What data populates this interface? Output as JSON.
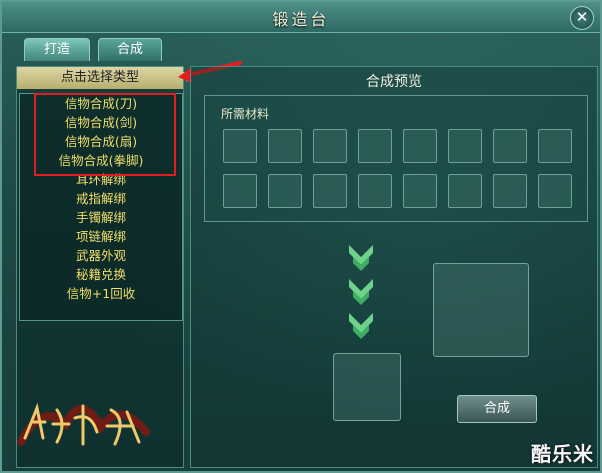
{
  "window": {
    "title": "锻造台"
  },
  "tabs": [
    {
      "label": "打造",
      "active": true
    },
    {
      "label": "合成",
      "active": false
    }
  ],
  "type_selector": {
    "label": "点击选择类型"
  },
  "type_list": [
    "信物合成(刀)",
    "信物合成(剑)",
    "信物合成(扇)",
    "信物合成(拳脚)",
    "耳环解绑",
    "戒指解绑",
    "手镯解绑",
    "项链解绑",
    "武器外观",
    "秘籍兑换",
    "信物+1回收"
  ],
  "preview": {
    "title": "合成预览",
    "materials_label": "所需材料",
    "compose_button": "合成"
  },
  "watermark": "酷乐米",
  "logo_text": "绝世秘籍",
  "icons": {
    "close": "close-icon",
    "dropdown": "chevron-down-icon",
    "arrow": "down-arrow-icon"
  },
  "colors": {
    "accent_gold": "#f0de6a",
    "highlight_red": "#e02020",
    "panel_teal": "#1d4a46"
  }
}
